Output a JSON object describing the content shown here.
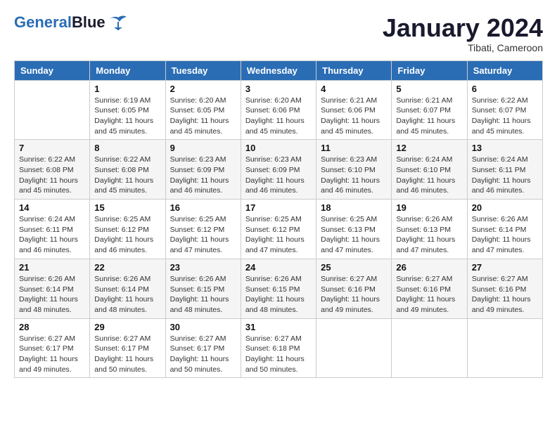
{
  "header": {
    "logo_line1": "General",
    "logo_line2": "Blue",
    "title": "January 2024",
    "subtitle": "Tibati, Cameroon"
  },
  "calendar": {
    "days_of_week": [
      "Sunday",
      "Monday",
      "Tuesday",
      "Wednesday",
      "Thursday",
      "Friday",
      "Saturday"
    ],
    "weeks": [
      [
        {
          "num": "",
          "info": ""
        },
        {
          "num": "1",
          "info": "Sunrise: 6:19 AM\nSunset: 6:05 PM\nDaylight: 11 hours\nand 45 minutes."
        },
        {
          "num": "2",
          "info": "Sunrise: 6:20 AM\nSunset: 6:05 PM\nDaylight: 11 hours\nand 45 minutes."
        },
        {
          "num": "3",
          "info": "Sunrise: 6:20 AM\nSunset: 6:06 PM\nDaylight: 11 hours\nand 45 minutes."
        },
        {
          "num": "4",
          "info": "Sunrise: 6:21 AM\nSunset: 6:06 PM\nDaylight: 11 hours\nand 45 minutes."
        },
        {
          "num": "5",
          "info": "Sunrise: 6:21 AM\nSunset: 6:07 PM\nDaylight: 11 hours\nand 45 minutes."
        },
        {
          "num": "6",
          "info": "Sunrise: 6:22 AM\nSunset: 6:07 PM\nDaylight: 11 hours\nand 45 minutes."
        }
      ],
      [
        {
          "num": "7",
          "info": "Sunrise: 6:22 AM\nSunset: 6:08 PM\nDaylight: 11 hours\nand 45 minutes."
        },
        {
          "num": "8",
          "info": "Sunrise: 6:22 AM\nSunset: 6:08 PM\nDaylight: 11 hours\nand 45 minutes."
        },
        {
          "num": "9",
          "info": "Sunrise: 6:23 AM\nSunset: 6:09 PM\nDaylight: 11 hours\nand 46 minutes."
        },
        {
          "num": "10",
          "info": "Sunrise: 6:23 AM\nSunset: 6:09 PM\nDaylight: 11 hours\nand 46 minutes."
        },
        {
          "num": "11",
          "info": "Sunrise: 6:23 AM\nSunset: 6:10 PM\nDaylight: 11 hours\nand 46 minutes."
        },
        {
          "num": "12",
          "info": "Sunrise: 6:24 AM\nSunset: 6:10 PM\nDaylight: 11 hours\nand 46 minutes."
        },
        {
          "num": "13",
          "info": "Sunrise: 6:24 AM\nSunset: 6:11 PM\nDaylight: 11 hours\nand 46 minutes."
        }
      ],
      [
        {
          "num": "14",
          "info": "Sunrise: 6:24 AM\nSunset: 6:11 PM\nDaylight: 11 hours\nand 46 minutes."
        },
        {
          "num": "15",
          "info": "Sunrise: 6:25 AM\nSunset: 6:12 PM\nDaylight: 11 hours\nand 46 minutes."
        },
        {
          "num": "16",
          "info": "Sunrise: 6:25 AM\nSunset: 6:12 PM\nDaylight: 11 hours\nand 47 minutes."
        },
        {
          "num": "17",
          "info": "Sunrise: 6:25 AM\nSunset: 6:12 PM\nDaylight: 11 hours\nand 47 minutes."
        },
        {
          "num": "18",
          "info": "Sunrise: 6:25 AM\nSunset: 6:13 PM\nDaylight: 11 hours\nand 47 minutes."
        },
        {
          "num": "19",
          "info": "Sunrise: 6:26 AM\nSunset: 6:13 PM\nDaylight: 11 hours\nand 47 minutes."
        },
        {
          "num": "20",
          "info": "Sunrise: 6:26 AM\nSunset: 6:14 PM\nDaylight: 11 hours\nand 47 minutes."
        }
      ],
      [
        {
          "num": "21",
          "info": "Sunrise: 6:26 AM\nSunset: 6:14 PM\nDaylight: 11 hours\nand 48 minutes."
        },
        {
          "num": "22",
          "info": "Sunrise: 6:26 AM\nSunset: 6:14 PM\nDaylight: 11 hours\nand 48 minutes."
        },
        {
          "num": "23",
          "info": "Sunrise: 6:26 AM\nSunset: 6:15 PM\nDaylight: 11 hours\nand 48 minutes."
        },
        {
          "num": "24",
          "info": "Sunrise: 6:26 AM\nSunset: 6:15 PM\nDaylight: 11 hours\nand 48 minutes."
        },
        {
          "num": "25",
          "info": "Sunrise: 6:27 AM\nSunset: 6:16 PM\nDaylight: 11 hours\nand 49 minutes."
        },
        {
          "num": "26",
          "info": "Sunrise: 6:27 AM\nSunset: 6:16 PM\nDaylight: 11 hours\nand 49 minutes."
        },
        {
          "num": "27",
          "info": "Sunrise: 6:27 AM\nSunset: 6:16 PM\nDaylight: 11 hours\nand 49 minutes."
        }
      ],
      [
        {
          "num": "28",
          "info": "Sunrise: 6:27 AM\nSunset: 6:17 PM\nDaylight: 11 hours\nand 49 minutes."
        },
        {
          "num": "29",
          "info": "Sunrise: 6:27 AM\nSunset: 6:17 PM\nDaylight: 11 hours\nand 50 minutes."
        },
        {
          "num": "30",
          "info": "Sunrise: 6:27 AM\nSunset: 6:17 PM\nDaylight: 11 hours\nand 50 minutes."
        },
        {
          "num": "31",
          "info": "Sunrise: 6:27 AM\nSunset: 6:18 PM\nDaylight: 11 hours\nand 50 minutes."
        },
        {
          "num": "",
          "info": ""
        },
        {
          "num": "",
          "info": ""
        },
        {
          "num": "",
          "info": ""
        }
      ]
    ]
  }
}
